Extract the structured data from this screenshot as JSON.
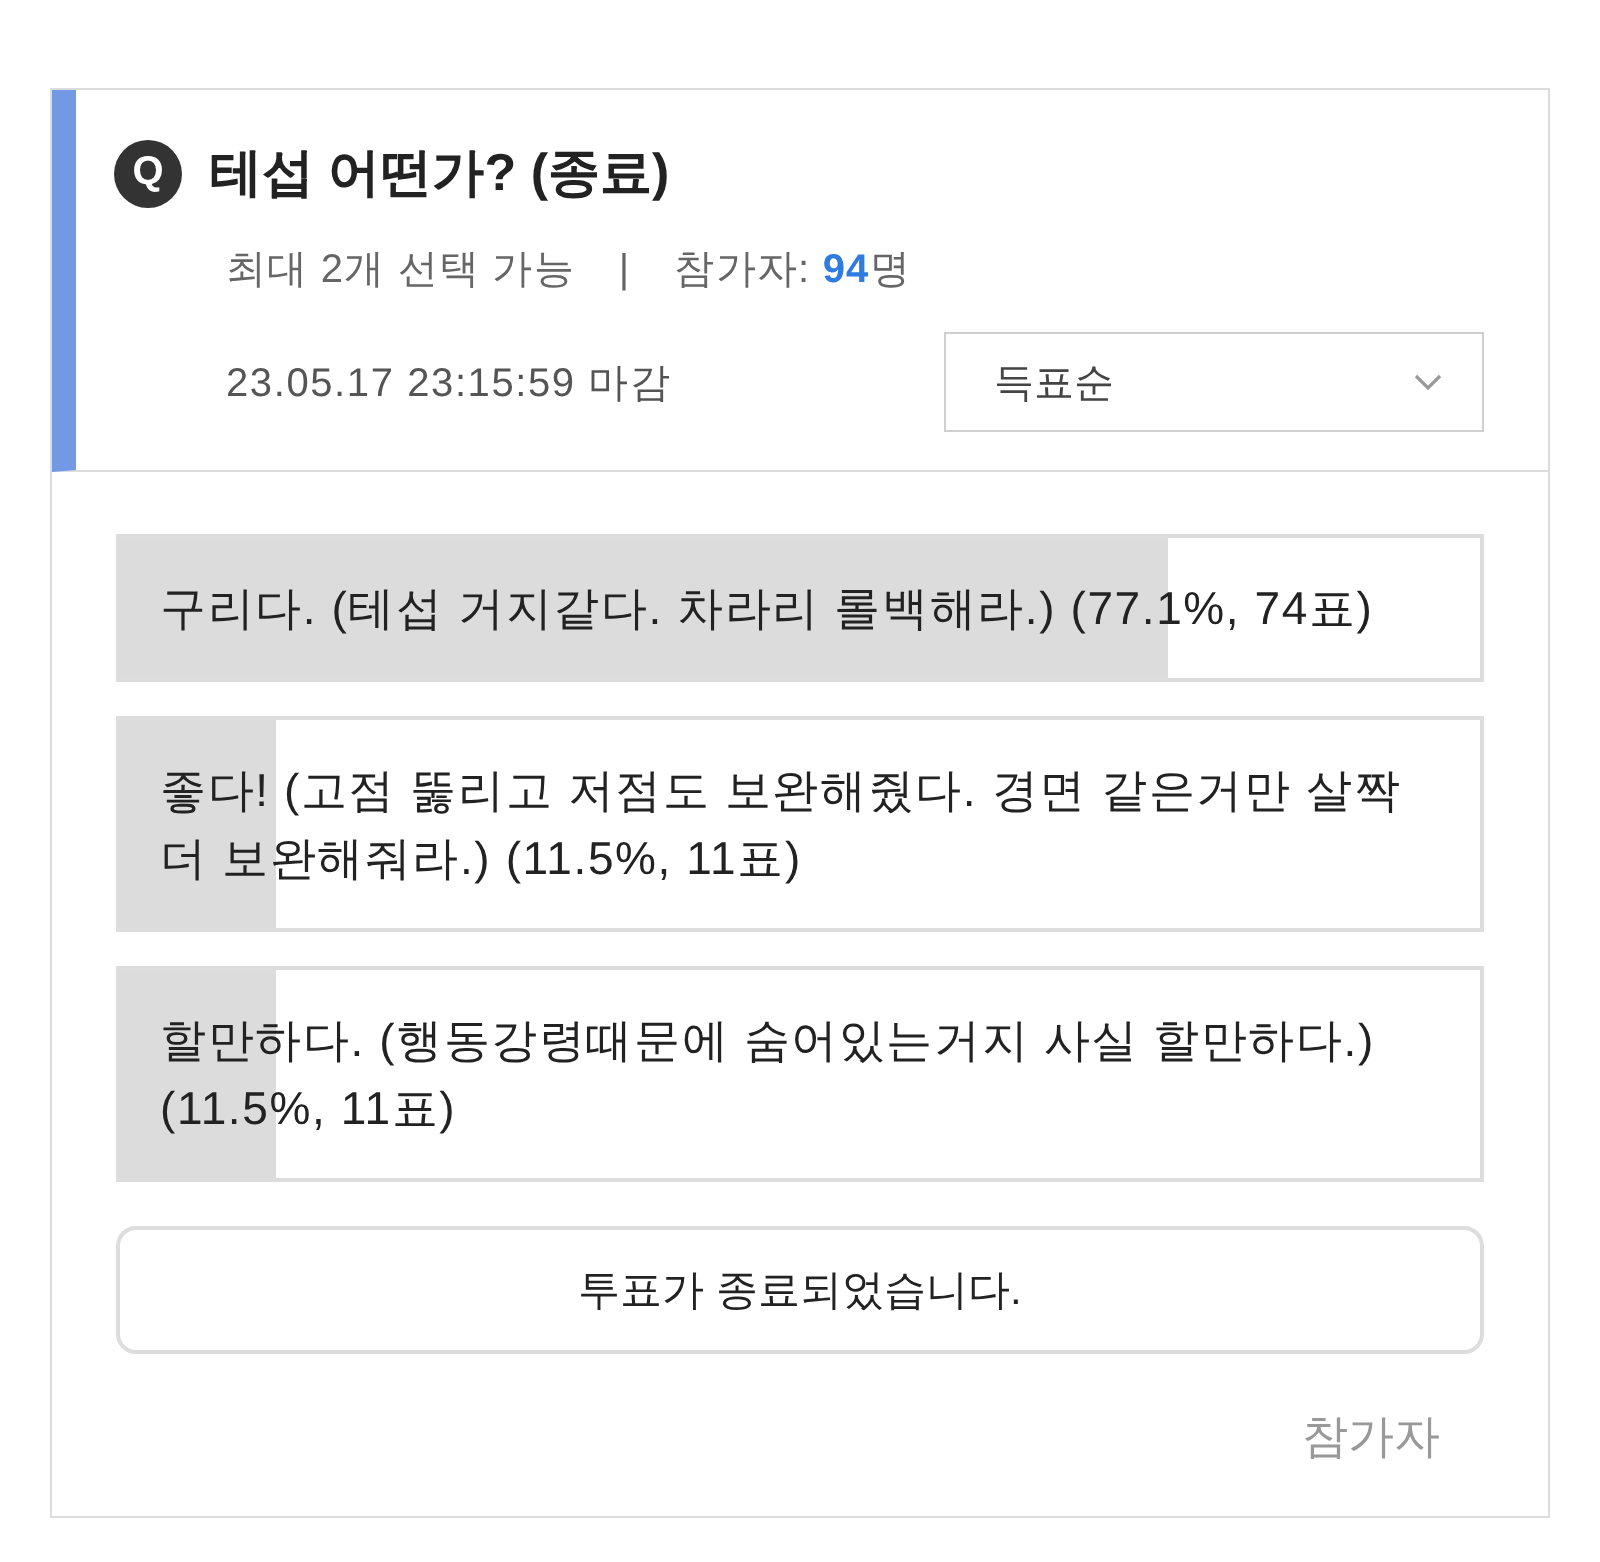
{
  "poll": {
    "badge": "Q",
    "title": "테섭 어떤가? (종료)",
    "limit": "최대 2개 선택 가능",
    "separator": "|",
    "participants": "참가자: **94**명",
    "deadline": "23.05.17 23:15:59 마감",
    "sort": {
      "value": "득표순"
    }
  },
  "options": [
    {
      "text": "구리다. (테섭 거지같다. 차라리 롤백해라.) (77.1%, 74표)",
      "level": 0.771
    },
    {
      "text": "좋다! (고점 뚫리고 저점도 보완해줬다. 경면 같은거만 살짝 더 보완해줘라.) (11.5%, 11표)",
      "level": 0.115
    },
    {
      "text": "할만하다. (행동강령때문에 숨어있는거지 사실 할만하다.) (11.5%, 11표)",
      "level": 0.115
    }
  ],
  "status_button": "투표가 종료되었습니다.",
  "participants_link": "참가자"
}
